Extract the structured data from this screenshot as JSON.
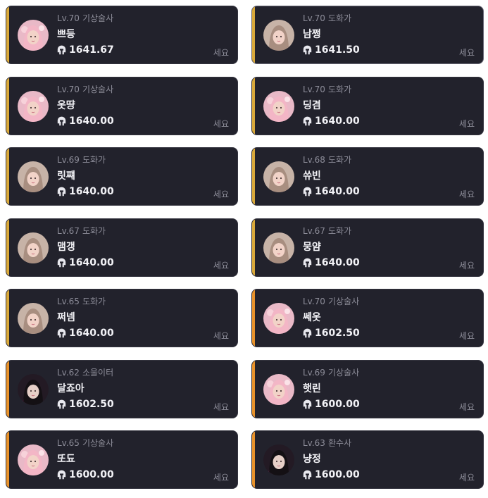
{
  "accent_colors": {
    "gold": "#d9a93a",
    "orange": "#e8922a"
  },
  "cards": [
    {
      "level": "Lv.70",
      "class": "기상술사",
      "name": "쁘등",
      "score": "1641.67",
      "server": "세요",
      "accent": "gold",
      "avatar": "pink-hair-character",
      "selected": false
    },
    {
      "level": "Lv.70",
      "class": "도화가",
      "name": "남쩡",
      "score": "1641.50",
      "server": "세요",
      "accent": "gold",
      "avatar": "brown-hair-character",
      "selected": true
    },
    {
      "level": "Lv.70",
      "class": "기상술사",
      "name": "옷땽",
      "score": "1640.00",
      "server": "세요",
      "accent": "gold",
      "avatar": "pink-hair-character",
      "selected": false
    },
    {
      "level": "Lv.70",
      "class": "도화가",
      "name": "딩겸",
      "score": "1640.00",
      "server": "세요",
      "accent": "gold",
      "avatar": "pink-hair-character",
      "selected": false
    },
    {
      "level": "Lv.69",
      "class": "도화가",
      "name": "릿쨰",
      "score": "1640.00",
      "server": "세요",
      "accent": "gold",
      "avatar": "brown-hair-character",
      "selected": false
    },
    {
      "level": "Lv.68",
      "class": "도화가",
      "name": "쓔빈",
      "score": "1640.00",
      "server": "세요",
      "accent": "gold",
      "avatar": "brown-hair-character",
      "selected": false
    },
    {
      "level": "Lv.67",
      "class": "도화가",
      "name": "맴갱",
      "score": "1640.00",
      "server": "세요",
      "accent": "gold",
      "avatar": "brown-hair-character",
      "selected": false
    },
    {
      "level": "Lv.67",
      "class": "도화가",
      "name": "뭉얌",
      "score": "1640.00",
      "server": "세요",
      "accent": "gold",
      "avatar": "brown-hair-character",
      "selected": false
    },
    {
      "level": "Lv.65",
      "class": "도화가",
      "name": "쩌넴",
      "score": "1640.00",
      "server": "세요",
      "accent": "gold",
      "avatar": "brown-hair-character",
      "selected": false
    },
    {
      "level": "Lv.70",
      "class": "기상술사",
      "name": "쎄옷",
      "score": "1602.50",
      "server": "세요",
      "accent": "orange",
      "avatar": "pink-hair-character",
      "selected": false
    },
    {
      "level": "Lv.62",
      "class": "소울이터",
      "name": "달죠아",
      "score": "1602.50",
      "server": "세요",
      "accent": "orange",
      "avatar": "dark-hair-character",
      "selected": false
    },
    {
      "level": "Lv.69",
      "class": "기상술사",
      "name": "햇린",
      "score": "1600.00",
      "server": "세요",
      "accent": "orange",
      "avatar": "pink-hair-character",
      "selected": false
    },
    {
      "level": "Lv.65",
      "class": "기상술사",
      "name": "또됴",
      "score": "1600.00",
      "server": "세요",
      "accent": "orange",
      "avatar": "pink-hair-character",
      "selected": false
    },
    {
      "level": "Lv.63",
      "class": "환수사",
      "name": "냥정",
      "score": "1600.00",
      "server": "세요",
      "accent": "orange",
      "avatar": "dark-hair-character",
      "selected": false
    }
  ]
}
